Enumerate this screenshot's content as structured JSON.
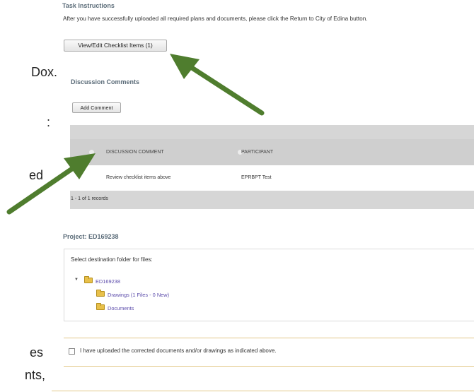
{
  "slide": {
    "frag_1": "Dox.",
    "frag_2": ":",
    "frag_3": "ed",
    "frag_4": "es",
    "frag_5": "nts,"
  },
  "task": {
    "title": "Task Instructions",
    "instruction": "After you have successfully uploaded all required plans and documents, please click the Return to City of Edina button.",
    "view_edit_label": "View/Edit Checklist Items (1)"
  },
  "discussion": {
    "title": "Discussion Comments",
    "add_comment_label": "Add Comment",
    "columns": [
      "DISCUSSION COMMENT",
      "PARTICIPANT"
    ],
    "rows": [
      {
        "comment": "Review checklist items above",
        "participant": "EPRBPT Test"
      }
    ],
    "records_text": "1 - 1 of 1 records"
  },
  "project": {
    "title": "Project: ED169238",
    "destination_label": "Select destination folder for files:",
    "tree_root": "ED169238",
    "folders": [
      "Drawings (1 Files - 0 New)",
      "Documents"
    ]
  },
  "confirm": {
    "checkbox_label": "I have uploaded the corrected documents and/or drawings as indicated above.",
    "checked": false
  },
  "colors": {
    "arrow_green": "#4f7d2e",
    "header_gray": "#cfcfcf",
    "separator_tan": "#e2c888",
    "link_purple": "#5c4cab",
    "section_title": "#5a6b78"
  }
}
